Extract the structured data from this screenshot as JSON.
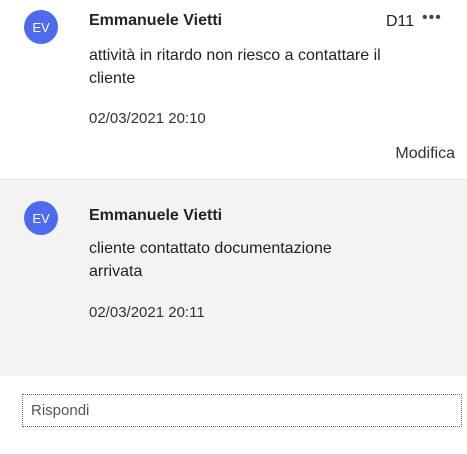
{
  "comments": [
    {
      "initials": "EV",
      "author": "Emmanuele Vietti",
      "ref": "D11",
      "more_glyph": "•••",
      "text": "attività in ritardo non riesco a contattare il cliente",
      "timestamp": "02/03/2021 20:10",
      "edit_label": "Modifica"
    },
    {
      "initials": "EV",
      "author": "Emmanuele Vietti",
      "text": "cliente contattato documentazione arrivata",
      "timestamp": "02/03/2021 20:11"
    }
  ],
  "reply": {
    "placeholder": "Rispondi"
  },
  "colors": {
    "avatar": "#4f6bed",
    "reply_bg": "#f3f3f3"
  }
}
